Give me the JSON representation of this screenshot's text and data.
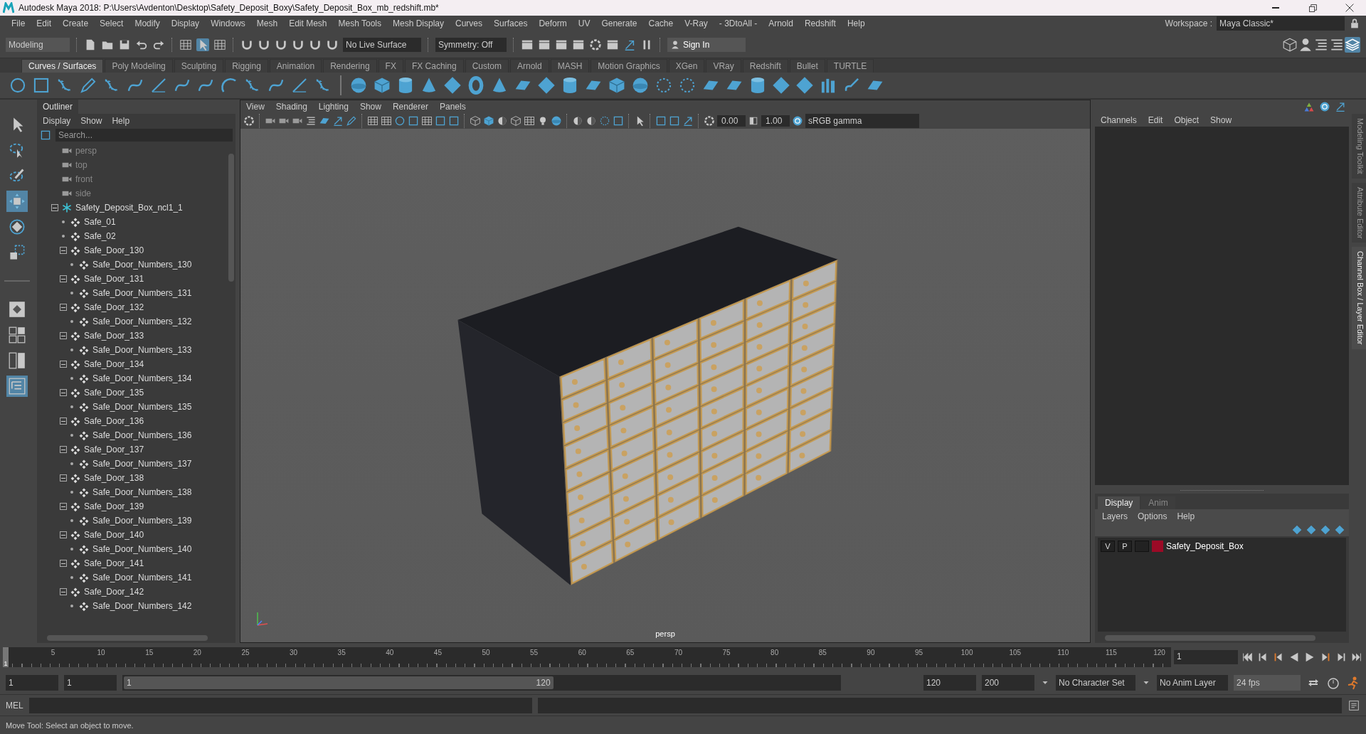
{
  "title_bar": {
    "title": "Autodesk Maya 2018: P:\\Users\\Avdenton\\Desktop\\Safety_Deposit_Boxy\\Safety_Deposit_Box_mb_redshift.mb*"
  },
  "menu_bar": [
    "File",
    "Edit",
    "Create",
    "Select",
    "Modify",
    "Display",
    "Windows",
    "Mesh",
    "Edit Mesh",
    "Mesh Tools",
    "Mesh Display",
    "Curves",
    "Surfaces",
    "Deform",
    "UV",
    "Generate",
    "Cache",
    "V-Ray",
    "- 3DtoAll -",
    "Arnold",
    "Redshift",
    "Help"
  ],
  "workspace": {
    "label": "Workspace :",
    "value": "Maya Classic*"
  },
  "status_line": {
    "mode": "Modeling",
    "live_surface": "No Live Surface",
    "symmetry": "Symmetry: Off",
    "sign_in": "Sign In"
  },
  "shelf": {
    "tabs": [
      {
        "label": "Curves / Surfaces",
        "selected": true
      },
      {
        "label": "Poly Modeling",
        "selected": false
      },
      {
        "label": "Sculpting",
        "selected": false
      },
      {
        "label": "Rigging",
        "selected": false
      },
      {
        "label": "Animation",
        "selected": false
      },
      {
        "label": "Rendering",
        "selected": false
      },
      {
        "label": "FX",
        "selected": false
      },
      {
        "label": "FX Caching",
        "selected": false
      },
      {
        "label": "Custom",
        "selected": false
      },
      {
        "label": "Arnold",
        "selected": false
      },
      {
        "label": "MASH",
        "selected": false
      },
      {
        "label": "Motion Graphics",
        "selected": false
      },
      {
        "label": "XGen",
        "selected": false
      },
      {
        "label": "VRay",
        "selected": false
      },
      {
        "label": "Redshift",
        "selected": false
      },
      {
        "label": "Bullet",
        "selected": false
      },
      {
        "label": "TURTLE",
        "selected": false
      }
    ]
  },
  "toolbox": [
    {
      "kind": "arrow",
      "selected": false
    },
    {
      "kind": "lasso",
      "selected": false
    },
    {
      "kind": "paint",
      "selected": false
    },
    {
      "kind": "move",
      "selected": true
    },
    {
      "kind": "rotate",
      "selected": false
    },
    {
      "kind": "scale",
      "selected": false
    },
    {
      "kind": "single-view",
      "selected": false
    },
    {
      "kind": "four-view",
      "selected": false
    },
    {
      "kind": "two-view",
      "selected": false
    },
    {
      "kind": "outliner-layout",
      "selected": true
    }
  ],
  "outliner": {
    "title": "Outliner",
    "menu": [
      "Display",
      "Show",
      "Help"
    ],
    "search": {
      "placeholder": "Search..."
    },
    "items": [
      {
        "label": "persp",
        "kind": "camera"
      },
      {
        "label": "top",
        "kind": "camera"
      },
      {
        "label": "front",
        "kind": "camera"
      },
      {
        "label": "side",
        "kind": "camera"
      },
      {
        "label": "Safety_Deposit_Box_ncl1_1",
        "kind": "group",
        "expanded": true,
        "children": [
          {
            "label": "Safe_01",
            "kind": "mesh"
          },
          {
            "label": "Safe_02",
            "kind": "mesh"
          },
          {
            "label": "Safe_Door_130",
            "kind": "mesh",
            "expanded": true,
            "children": [
              {
                "label": "Safe_Door_Numbers_130",
                "kind": "mesh"
              }
            ]
          },
          {
            "label": "Safe_Door_131",
            "kind": "mesh",
            "expanded": true,
            "children": [
              {
                "label": "Safe_Door_Numbers_131",
                "kind": "mesh"
              }
            ]
          },
          {
            "label": "Safe_Door_132",
            "kind": "mesh",
            "expanded": true,
            "children": [
              {
                "label": "Safe_Door_Numbers_132",
                "kind": "mesh"
              }
            ]
          },
          {
            "label": "Safe_Door_133",
            "kind": "mesh",
            "expanded": true,
            "children": [
              {
                "label": "Safe_Door_Numbers_133",
                "kind": "mesh"
              }
            ]
          },
          {
            "label": "Safe_Door_134",
            "kind": "mesh",
            "expanded": true,
            "children": [
              {
                "label": "Safe_Door_Numbers_134",
                "kind": "mesh"
              }
            ]
          },
          {
            "label": "Safe_Door_135",
            "kind": "mesh",
            "expanded": true,
            "children": [
              {
                "label": "Safe_Door_Numbers_135",
                "kind": "mesh"
              }
            ]
          },
          {
            "label": "Safe_Door_136",
            "kind": "mesh",
            "expanded": true,
            "children": [
              {
                "label": "Safe_Door_Numbers_136",
                "kind": "mesh"
              }
            ]
          },
          {
            "label": "Safe_Door_137",
            "kind": "mesh",
            "expanded": true,
            "children": [
              {
                "label": "Safe_Door_Numbers_137",
                "kind": "mesh"
              }
            ]
          },
          {
            "label": "Safe_Door_138",
            "kind": "mesh",
            "expanded": true,
            "children": [
              {
                "label": "Safe_Door_Numbers_138",
                "kind": "mesh"
              }
            ]
          },
          {
            "label": "Safe_Door_139",
            "kind": "mesh",
            "expanded": true,
            "children": [
              {
                "label": "Safe_Door_Numbers_139",
                "kind": "mesh"
              }
            ]
          },
          {
            "label": "Safe_Door_140",
            "kind": "mesh",
            "expanded": true,
            "children": [
              {
                "label": "Safe_Door_Numbers_140",
                "kind": "mesh"
              }
            ]
          },
          {
            "label": "Safe_Door_141",
            "kind": "mesh",
            "expanded": true,
            "children": [
              {
                "label": "Safe_Door_Numbers_141",
                "kind": "mesh"
              }
            ]
          },
          {
            "label": "Safe_Door_142",
            "kind": "mesh",
            "expanded": true,
            "children": [
              {
                "label": "Safe_Door_Numbers_142",
                "kind": "mesh"
              }
            ]
          }
        ]
      }
    ]
  },
  "viewport": {
    "menu": [
      "View",
      "Shading",
      "Lighting",
      "Show",
      "Renderer",
      "Panels"
    ],
    "near": "0.00",
    "far": "1.00",
    "color_space": "sRGB gamma",
    "camera_label": "persp"
  },
  "channel_box": {
    "menu": [
      "Channels",
      "Edit",
      "Object",
      "Show"
    ]
  },
  "layer_editor": {
    "tabs": [
      {
        "label": "Display",
        "selected": true
      },
      {
        "label": "Anim",
        "selected": false
      }
    ],
    "menu": [
      "Layers",
      "Options",
      "Help"
    ],
    "layers": [
      {
        "visibility": "V",
        "playback": "P",
        "color": "#9b0a26",
        "name": "Safety_Deposit_Box"
      }
    ]
  },
  "side_tabs": [
    {
      "label": "Modeling Toolkit",
      "selected": false
    },
    {
      "label": "Attribute Editor",
      "selected": false
    },
    {
      "label": "Channel Box / Layer Editor",
      "selected": true
    }
  ],
  "timeline": {
    "current": "1",
    "ticks": [
      "5",
      "10",
      "15",
      "20",
      "25",
      "30",
      "35",
      "40",
      "45",
      "50",
      "55",
      "60",
      "65",
      "70",
      "75",
      "80",
      "85",
      "90",
      "95",
      "100",
      "105",
      "110",
      "115",
      "120"
    ],
    "current_frame": "1"
  },
  "range": {
    "level": 0.6,
    "start": "1",
    "playback_start": "1",
    "slider_start": "1",
    "slider_end": "120",
    "playback_end": "120",
    "end": "200",
    "character_set": "No Character Set",
    "anim_layer": "No Anim Layer",
    "fps": "24 fps"
  },
  "command_line": {
    "label": "MEL"
  },
  "help_line": "Move Tool: Select an object to move."
}
